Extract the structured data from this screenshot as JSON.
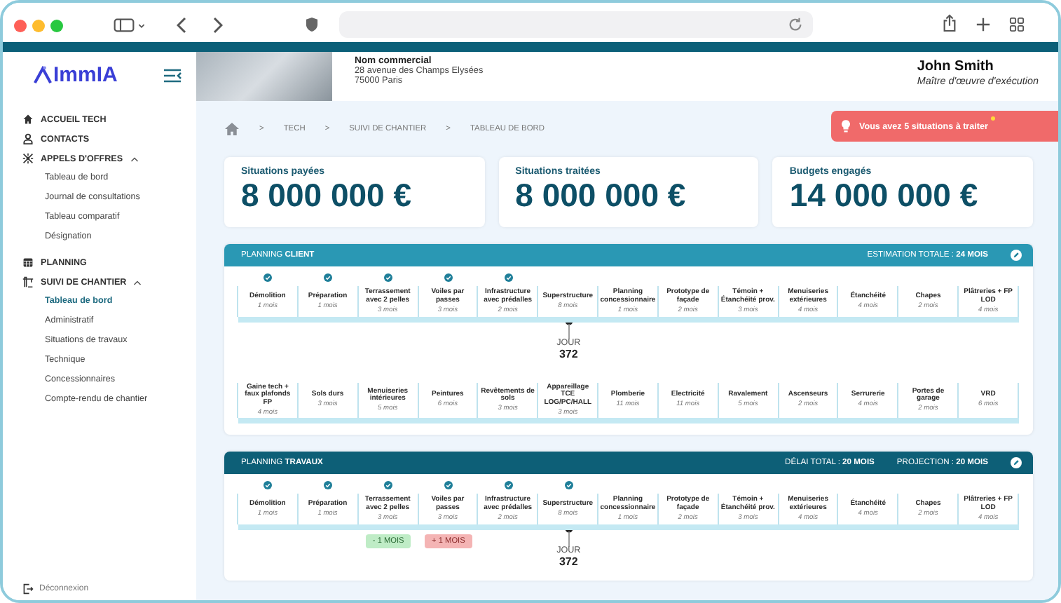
{
  "sidebar": {
    "logo": "ImmIA",
    "items": [
      {
        "label": "ACCUEIL TECH",
        "selected": false,
        "expanded": false
      },
      {
        "label": "CONTACTS",
        "selected": false,
        "expanded": false
      },
      {
        "label": "APPELS D'OFFRES",
        "selected": false,
        "expanded": true,
        "children": [
          {
            "label": "Tableau de bord",
            "selected": false
          },
          {
            "label": "Journal de consultations",
            "selected": false
          },
          {
            "label": "Tableau comparatif",
            "selected": false
          },
          {
            "label": "Désignation",
            "selected": false
          }
        ]
      },
      {
        "label": "PLANNING",
        "selected": false,
        "expanded": false
      },
      {
        "label": "SUIVI DE CHANTIER",
        "selected": false,
        "expanded": true,
        "children": [
          {
            "label": "Tableau de bord",
            "selected": true
          },
          {
            "label": "Administratif",
            "selected": false
          },
          {
            "label": "Situations de travaux",
            "selected": false
          },
          {
            "label": "Technique",
            "selected": false
          },
          {
            "label": "Concessionnaires",
            "selected": false
          },
          {
            "label": "Compte-rendu de chantier",
            "selected": false
          }
        ]
      }
    ],
    "logout": "Déconnexion"
  },
  "header": {
    "company": "Nom commercial",
    "address_lines": [
      "28 avenue des Champs Elysées",
      "75000 Paris"
    ],
    "user_name": "John Smith",
    "user_role": "Maître d'œuvre d'exécution"
  },
  "breadcrumb": [
    "TECH",
    "SUIVI DE CHANTIER",
    "TABLEAU DE BORD"
  ],
  "breadcrumb_separator": ">",
  "alert": {
    "text": "Vous avez 5 situations à traiter",
    "unread": true
  },
  "cards": [
    {
      "label": "Situations payées",
      "value": "8 000 000 €"
    },
    {
      "label": "Situations traitées",
      "value": "8 000 000 €"
    },
    {
      "label": "Budgets engagés",
      "value": "14 000 000 €"
    }
  ],
  "plannings": [
    {
      "kind": "client",
      "title": "PLANNING **CLIENT**",
      "totals": [
        "ESTIMATION TOTALE : **24 MOIS**"
      ],
      "marker": {
        "label": "JOUR",
        "value": "372"
      },
      "rows": [
        [
          {
            "label": "Démolition",
            "duration": "1 mois",
            "done": true,
            "current": false
          },
          {
            "label": "Préparation",
            "duration": "1 mois",
            "done": true,
            "current": false
          },
          {
            "label": "Terrassement avec 2 pelles",
            "duration": "3 mois",
            "done": true,
            "current": false
          },
          {
            "label": "Voiles par passes",
            "duration": "3 mois",
            "done": true,
            "current": false
          },
          {
            "label": "Infrastructure avec prédalles",
            "duration": "2 mois",
            "done": true,
            "current": false
          },
          {
            "label": "Superstructure",
            "duration": "8 mois",
            "done": false,
            "current": true
          },
          {
            "label": "Planning concessionnaire",
            "duration": "1 mois",
            "done": false,
            "current": false
          },
          {
            "label": "Prototype de façade",
            "duration": "2 mois",
            "done": false,
            "current": false
          },
          {
            "label": "Témoin + Étanchéité prov.",
            "duration": "3 mois",
            "done": false,
            "current": false
          },
          {
            "label": "Menuiseries extérieures",
            "duration": "4 mois",
            "done": false,
            "current": false
          },
          {
            "label": "Étanchéité",
            "duration": "4 mois",
            "done": false,
            "current": false
          },
          {
            "label": "Chapes",
            "duration": "2 mois",
            "done": false,
            "current": false
          },
          {
            "label": "Plâtreries + FP LOD",
            "duration": "4 mois",
            "done": false,
            "current": false
          }
        ],
        [
          {
            "label": "Gaine tech + faux plafonds FP",
            "duration": "4 mois",
            "done": false,
            "current": false
          },
          {
            "label": "Sols durs",
            "duration": "3 mois",
            "done": false,
            "current": false
          },
          {
            "label": "Menuiseries intérieures",
            "duration": "5 mois",
            "done": false,
            "current": false
          },
          {
            "label": "Peintures",
            "duration": "6 mois",
            "done": false,
            "current": false
          },
          {
            "label": "Revêtements de sols",
            "duration": "3 mois",
            "done": false,
            "current": false
          },
          {
            "label": "Appareillage TCE LOG/PC/HALL",
            "duration": "3 mois",
            "done": false,
            "current": false
          },
          {
            "label": "Plomberie",
            "duration": "11 mois",
            "done": false,
            "current": false
          },
          {
            "label": "Electricité",
            "duration": "11 mois",
            "done": false,
            "current": false
          },
          {
            "label": "Ravalement",
            "duration": "5 mois",
            "done": false,
            "current": false
          },
          {
            "label": "Ascenseurs",
            "duration": "2 mois",
            "done": false,
            "current": false
          },
          {
            "label": "Serrurerie",
            "duration": "4 mois",
            "done": false,
            "current": false
          },
          {
            "label": "Portes de garage",
            "duration": "2 mois",
            "done": false,
            "current": false
          },
          {
            "label": "VRD",
            "duration": "6 mois",
            "done": false,
            "current": false
          }
        ]
      ]
    },
    {
      "kind": "travaux",
      "title": "PLANNING **TRAVAUX**",
      "totals": [
        "DÉLAI TOTAL : **20 MOIS**",
        "PROJECTION : **20 MOIS**"
      ],
      "marker": {
        "label": "JOUR",
        "value": "372"
      },
      "rows": [
        [
          {
            "label": "Démolition",
            "duration": "1 mois",
            "done": true,
            "current": false
          },
          {
            "label": "Préparation",
            "duration": "1 mois",
            "done": true,
            "current": false
          },
          {
            "label": "Terrassement avec 2 pelles",
            "duration": "3 mois",
            "done": true,
            "current": false,
            "delta": {
              "text": "- 1 MOIS",
              "kind": "ahead"
            }
          },
          {
            "label": "Voiles par passes",
            "duration": "3 mois",
            "done": true,
            "current": false,
            "delta": {
              "text": "+ 1 MOIS",
              "kind": "late"
            }
          },
          {
            "label": "Infrastructure avec prédalles",
            "duration": "2 mois",
            "done": true,
            "current": false
          },
          {
            "label": "Superstructure",
            "duration": "8 mois",
            "done": true,
            "current": true
          },
          {
            "label": "Planning concessionnaire",
            "duration": "1 mois",
            "done": false,
            "current": false
          },
          {
            "label": "Prototype de façade",
            "duration": "2 mois",
            "done": false,
            "current": false
          },
          {
            "label": "Témoin + Étanchéité prov.",
            "duration": "3 mois",
            "done": false,
            "current": false
          },
          {
            "label": "Menuiseries extérieures",
            "duration": "4 mois",
            "done": false,
            "current": false
          },
          {
            "label": "Étanchéité",
            "duration": "4 mois",
            "done": false,
            "current": false
          },
          {
            "label": "Chapes",
            "duration": "2 mois",
            "done": false,
            "current": false
          },
          {
            "label": "Plâtreries + FP LOD",
            "duration": "4 mois",
            "done": false,
            "current": false
          }
        ]
      ]
    }
  ]
}
